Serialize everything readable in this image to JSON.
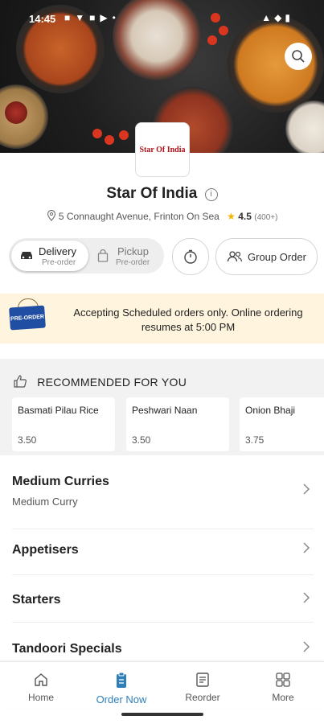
{
  "status_bar": {
    "time": "14:45"
  },
  "restaurant": {
    "logo_text": "Star Of India",
    "name": "Star Of India",
    "info_glyph": "i",
    "address": "5 Connaught Avenue, Frinton On Sea",
    "rating": "4.5",
    "rating_count": "(400+)"
  },
  "order_modes": {
    "delivery": {
      "label": "Delivery",
      "sub": "Pre-order"
    },
    "pickup": {
      "label": "Pickup",
      "sub": "Pre-order"
    },
    "group_order_label": "Group Order"
  },
  "banner": {
    "tag_text": "PRE-ORDER",
    "message": "Accepting Scheduled orders only. Online ordering resumes at 5:00 PM"
  },
  "recommended": {
    "title": "RECOMMENDED FOR YOU",
    "items": [
      {
        "name": "Basmati Pilau Rice",
        "price": "3.50"
      },
      {
        "name": "Peshwari Naan",
        "price": "3.50"
      },
      {
        "name": "Onion Bhaji",
        "price": "3.75"
      }
    ]
  },
  "categories": [
    {
      "title": "Medium Curries",
      "subtitle": "Medium Curry"
    },
    {
      "title": "Appetisers",
      "subtitle": ""
    },
    {
      "title": "Starters",
      "subtitle": ""
    },
    {
      "title": "Tandoori Specials",
      "subtitle": ""
    }
  ],
  "bottom_nav": [
    {
      "label": "Home"
    },
    {
      "label": "Order Now"
    },
    {
      "label": "Reorder"
    },
    {
      "label": "More"
    }
  ],
  "colors": {
    "accent": "#2e7fb8",
    "banner_bg": "#fff5df",
    "star": "#f5b400"
  }
}
